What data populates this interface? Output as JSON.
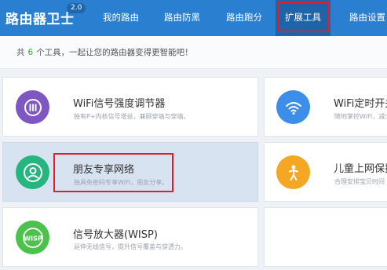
{
  "header": {
    "brand": "路由器卫士",
    "version": "2.0",
    "nav": [
      {
        "label": "我的路由"
      },
      {
        "label": "路由防黑"
      },
      {
        "label": "路由跑分"
      },
      {
        "label": "扩展工具"
      },
      {
        "label": "路由设置"
      }
    ],
    "active_tab": "扩展工具",
    "highlight_color": "#e11f2a"
  },
  "summary": {
    "prefix": "共",
    "count": "6",
    "suffix": "个工具，一起让您的路由器变得更智能吧！"
  },
  "tools": [
    {
      "title": "WiFi信号强度调节器",
      "desc": "独有P+内核信号增益，兼顾穿墙与穿墙。",
      "icon": "signal-level-icon",
      "color": "#7e57c2"
    },
    {
      "title": "WiFi定时开关",
      "desc": "随地掌控WiFi，减少",
      "icon": "wifi-icon",
      "color": "#3d8ee8"
    },
    {
      "title": "朋友专享网络",
      "desc": "独具免密码专享WiFi，朋友分享。",
      "icon": "user-icon",
      "color": "#26b57f"
    },
    {
      "title": "儿童上网保护",
      "desc": "合理安排宝贝时间",
      "icon": "child-icon",
      "color": "#f5a623"
    },
    {
      "title": "信号放大器(WISP)",
      "desc": "延伸无线信号，提升信号覆盖与穿透力。",
      "icon": "wisp-icon",
      "color": "#4cc24c"
    }
  ],
  "colors": {
    "header_bg": "#2b7fd1",
    "active_tab_bg": "#1f64a8",
    "selected_card_bg": "#d8e3f2"
  }
}
